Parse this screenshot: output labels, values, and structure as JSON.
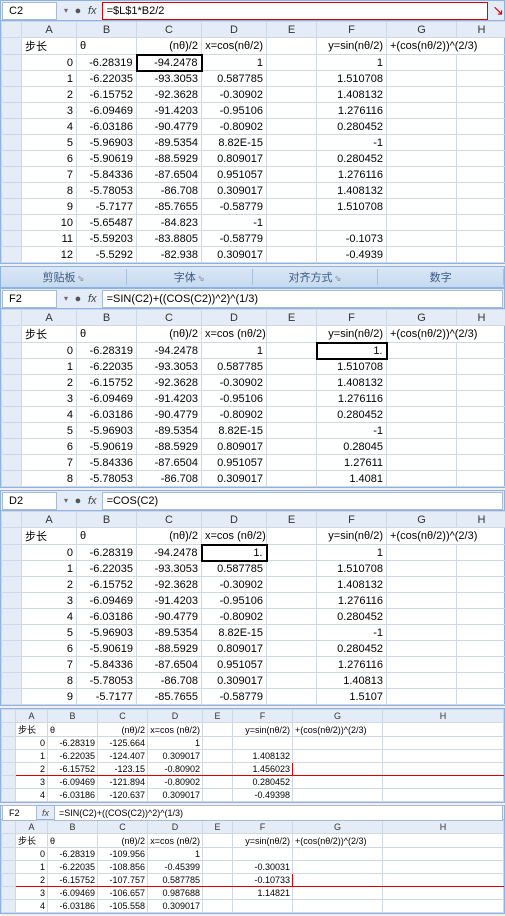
{
  "ribbon": {
    "g1": "剪贴板",
    "g2": "字体",
    "g3": "对齐方式",
    "g4": "数字"
  },
  "hdr": {
    "step": "步长",
    "theta": "θ",
    "nth2": "(nθ)/2",
    "xcos": "x=cos(nθ/2)",
    "xcos2": "x=cos (nθ/2)",
    "ysin": "y=sin(nθ/2)",
    "plus": "+(cos(nθ/2))^(2/3)"
  },
  "p1": {
    "cell": "C2",
    "formula": "=$L$1*B2/2",
    "rows": [
      {
        "n": "0",
        "b": "-6.28319",
        "c": "-94.2478",
        "d": "1",
        "f": "1"
      },
      {
        "n": "1",
        "b": "-6.22035",
        "c": "-93.3053",
        "d": "0.587785",
        "f": "1.510708"
      },
      {
        "n": "2",
        "b": "-6.15752",
        "c": "-92.3628",
        "d": "-0.30902",
        "f": "1.408132"
      },
      {
        "n": "3",
        "b": "-6.09469",
        "c": "-91.4203",
        "d": "-0.95106",
        "f": "1.276116"
      },
      {
        "n": "4",
        "b": "-6.03186",
        "c": "-90.4779",
        "d": "-0.80902",
        "f": "0.280452"
      },
      {
        "n": "5",
        "b": "-5.96903",
        "c": "-89.5354",
        "d": "8.82E-15",
        "f": "-1"
      },
      {
        "n": "6",
        "b": "-5.90619",
        "c": "-88.5929",
        "d": "0.809017",
        "f": "0.280452"
      },
      {
        "n": "7",
        "b": "-5.84336",
        "c": "-87.6504",
        "d": "0.951057",
        "f": "1.276116"
      },
      {
        "n": "8",
        "b": "-5.78053",
        "c": "-86.708",
        "d": "0.309017",
        "f": "1.408132"
      },
      {
        "n": "9",
        "b": "-5.7177",
        "c": "-85.7655",
        "d": "-0.58779",
        "f": "1.510708"
      },
      {
        "n": "10",
        "b": "-5.65487",
        "c": "-84.823",
        "d": "-1",
        "f": ""
      },
      {
        "n": "11",
        "b": "-5.59203",
        "c": "-83.8805",
        "d": "-0.58779",
        "f": "-0.1073"
      },
      {
        "n": "12",
        "b": "-5.5292",
        "c": "-82.938",
        "d": "0.309017",
        "f": "-0.4939"
      }
    ]
  },
  "p2": {
    "cell": "F2",
    "formula": "=SIN(C2)+((COS(C2))^2)^(1/3)",
    "rows": [
      {
        "n": "0",
        "b": "-6.28319",
        "c": "-94.2478",
        "d": "1",
        "f": "1."
      },
      {
        "n": "1",
        "b": "-6.22035",
        "c": "-93.3053",
        "d": "0.587785",
        "f": "1.510708"
      },
      {
        "n": "2",
        "b": "-6.15752",
        "c": "-92.3628",
        "d": "-0.30902",
        "f": "1.408132"
      },
      {
        "n": "3",
        "b": "-6.09469",
        "c": "-91.4203",
        "d": "-0.95106",
        "f": "1.276116"
      },
      {
        "n": "4",
        "b": "-6.03186",
        "c": "-90.4779",
        "d": "-0.80902",
        "f": "0.280452"
      },
      {
        "n": "5",
        "b": "-5.96903",
        "c": "-89.5354",
        "d": "8.82E-15",
        "f": "-1"
      },
      {
        "n": "6",
        "b": "-5.90619",
        "c": "-88.5929",
        "d": "0.809017",
        "f": "0.28045"
      },
      {
        "n": "7",
        "b": "-5.84336",
        "c": "-87.6504",
        "d": "0.951057",
        "f": "1.27611"
      },
      {
        "n": "8",
        "b": "-5.78053",
        "c": "-86.708",
        "d": "0.309017",
        "f": "1.4081"
      }
    ]
  },
  "p3": {
    "cell": "D2",
    "formula": "=COS(C2)",
    "rows": [
      {
        "n": "0",
        "b": "-6.28319",
        "c": "-94.2478",
        "d": "1.",
        "f": "1"
      },
      {
        "n": "1",
        "b": "-6.22035",
        "c": "-93.3053",
        "d": "0.587785",
        "f": "1.510708"
      },
      {
        "n": "2",
        "b": "-6.15752",
        "c": "-92.3628",
        "d": "-0.30902",
        "f": "1.408132"
      },
      {
        "n": "3",
        "b": "-6.09469",
        "c": "-91.4203",
        "d": "-0.95106",
        "f": "1.276116"
      },
      {
        "n": "4",
        "b": "-6.03186",
        "c": "-90.4779",
        "d": "-0.80902",
        "f": "0.280452"
      },
      {
        "n": "5",
        "b": "-5.96903",
        "c": "-89.5354",
        "d": "8.82E-15",
        "f": "-1"
      },
      {
        "n": "6",
        "b": "-5.90619",
        "c": "-88.5929",
        "d": "0.809017",
        "f": "0.280452"
      },
      {
        "n": "7",
        "b": "-5.84336",
        "c": "-87.6504",
        "d": "0.951057",
        "f": "1.276116"
      },
      {
        "n": "8",
        "b": "-5.78053",
        "c": "-86.708",
        "d": "0.309017",
        "f": "1.40813"
      },
      {
        "n": "9",
        "b": "-5.7177",
        "c": "-85.7655",
        "d": "-0.58779",
        "f": "1.5107"
      }
    ]
  },
  "p4": {
    "rows": [
      {
        "n": "0",
        "b": "-6.28319",
        "c": "-125.664",
        "d": "1",
        "f": ""
      },
      {
        "n": "1",
        "b": "-6.22035",
        "c": "-124.407",
        "d": "0.309017",
        "f": "1.408132"
      },
      {
        "n": "2",
        "b": "-6.15752",
        "c": "-123.15",
        "d": "-0.80902",
        "f": "1.456023"
      },
      {
        "n": "3",
        "b": "-6.09469",
        "c": "-121.894",
        "d": "-0.80902",
        "f": "0.280452"
      },
      {
        "n": "4",
        "b": "-6.03186",
        "c": "-120.637",
        "d": "0.309017",
        "f": "-0.49398"
      }
    ]
  },
  "p5": {
    "cell": "F2",
    "formula": "=SIN(C2)+((COS(C2))^2)^(1/3)",
    "rows": [
      {
        "n": "0",
        "b": "-6.28319",
        "c": "-109.956",
        "d": "1",
        "f": ""
      },
      {
        "n": "1",
        "b": "-6.22035",
        "c": "-108.856",
        "d": "-0.45399",
        "f": "-0.30031"
      },
      {
        "n": "2",
        "b": "-6.15752",
        "c": "-107.757",
        "d": "0.587785",
        "f": "-0.10733"
      },
      {
        "n": "3",
        "b": "-6.09469",
        "c": "-106.657",
        "d": "0.987688",
        "f": "1.14821"
      },
      {
        "n": "4",
        "b": "-6.03186",
        "c": "-105.558",
        "d": "0.309017",
        "f": ""
      }
    ]
  }
}
